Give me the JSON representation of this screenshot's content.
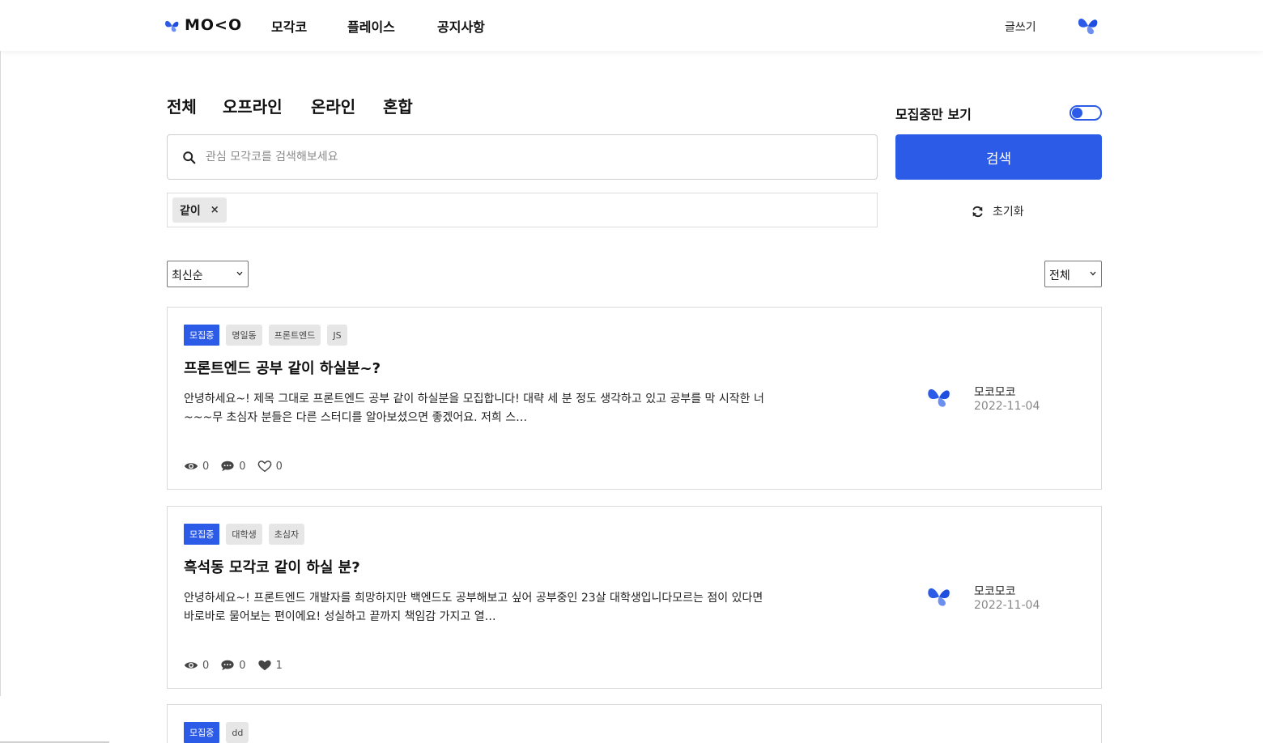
{
  "header": {
    "logo_text": "MO<O",
    "nav": [
      "모각코",
      "플레이스",
      "공지사항"
    ],
    "write_label": "글쓰기"
  },
  "filters": {
    "tabs": [
      "전체",
      "오프라인",
      "온라인",
      "혼합"
    ],
    "recruiting_toggle_label": "모집중만 보기",
    "recruiting_toggle_on": true,
    "search_placeholder": "관심 모각코를 검색해보세요",
    "search_button": "검색",
    "selected_tags": [
      {
        "label": "같이",
        "remove": "×"
      }
    ],
    "reset_label": "초기화",
    "sort_value": "최신순",
    "type_value": "전체"
  },
  "posts": [
    {
      "badges": [
        "모집중",
        "명일동",
        "프론트엔드",
        "JS"
      ],
      "title": "프론트엔드 공부 같이 하실분~?",
      "body_line1": "안녕하세요~! 제목 그대로 프론트엔드 공부 같이 하실분을 모집합니다! 대략 세 분 정도 생각하고 있고 공부를 막 시작한 너",
      "body_line2": "~~~무 초심자 분들은 다른 스터디를 알아보셨으면 좋겠어요. 저희 스…",
      "author": "모코모코",
      "date": "2022-11-04",
      "views": "0",
      "comments": "0",
      "likes": "0",
      "liked": false
    },
    {
      "badges": [
        "모집중",
        "대학생",
        "초심자"
      ],
      "title": "흑석동 모각코 같이 하실 분?",
      "body_line1": "안녕하세요~! 프론트엔드 개발자를 희망하지만 백엔드도 공부해보고 싶어 공부중인 23살 대학생입니다모르는 점이 있다면",
      "body_line2": "바로바로 물어보는 편이에요! 성실하고 끝까지 책임감 가지고 열…",
      "author": "모코모코",
      "date": "2022-11-04",
      "views": "0",
      "comments": "0",
      "likes": "1",
      "liked": true
    },
    {
      "badges": [
        "모집중",
        "dd"
      ]
    }
  ],
  "colors": {
    "accent": "#2c5be8",
    "logo_light": "#6e8ff2"
  },
  "icons": [
    "butterfly-logo-icon",
    "search-icon",
    "refresh-icon",
    "chevron-down-icon",
    "eye-icon",
    "comment-icon",
    "heart-icon"
  ]
}
